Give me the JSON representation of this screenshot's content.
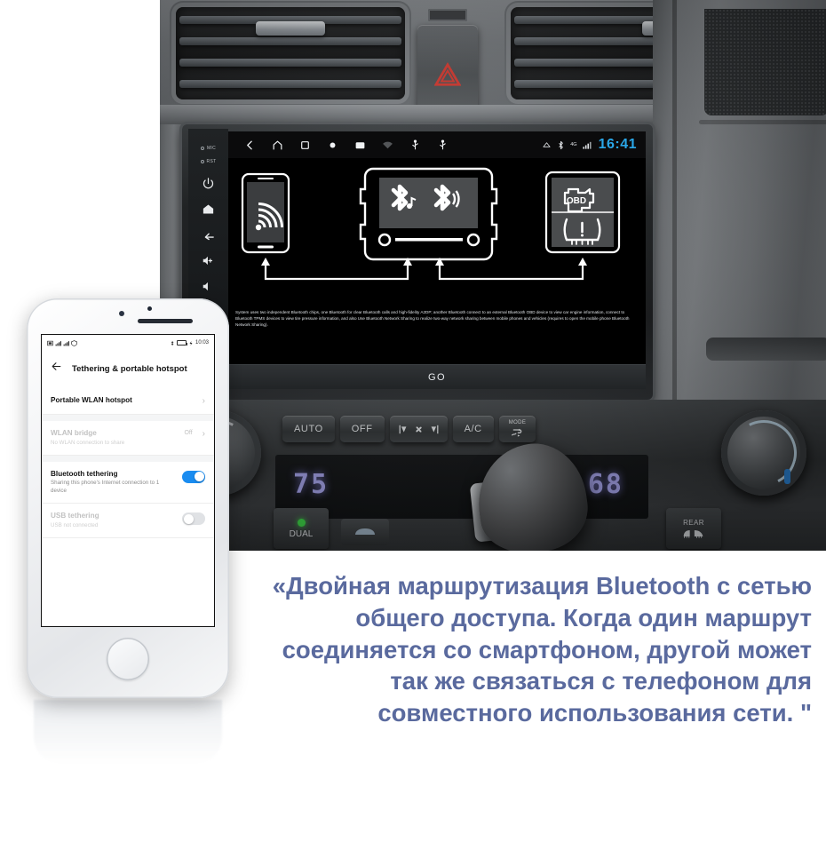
{
  "dashboard": {
    "hazard_button": "hazard-warning",
    "head_unit": {
      "hard_keys": {
        "mic_label": "MIC",
        "rst_label": "RST",
        "power": "power-icon",
        "home": "home-icon",
        "back": "back-icon",
        "volume_up": "volume-up-icon"
      },
      "status_bar": {
        "nav_icons": [
          "back-icon",
          "home-icon",
          "recents-icon",
          "circle-icon",
          "screenshot-icon",
          "wifi-icon",
          "usb-icon",
          "usb-icon"
        ],
        "right_icons": [
          "eject-icon",
          "bluetooth-icon",
          "4g-icon",
          "signal-icon"
        ],
        "network_label": "4G",
        "clock": "16:41"
      },
      "diagram": {
        "left_device": "smartphone-hotspot",
        "center_device": "car-head-unit-dual-bluetooth",
        "right_device": "obd-tpms-module",
        "obd_label": "OBD",
        "bt_left": "bluetooth-music-icon",
        "bt_right": "bluetooth-call-icon"
      },
      "description": "System uses two independent Bluetooth chips, one Bluetooth for clear Bluetooth calls and high-fidelity A2DP; another Bluetooth connect to an external Bluetooth OBD device to view car engine information, connect to Bluetooth TPMS devices to view tire pressure information, and also Use Bluetooth Network Sharing to realize two-way network sharing between mobile phones and vehicles (requires to open the mobile phone Bluetooth Network Sharing).",
      "go_button": "GO"
    },
    "climate": {
      "buttons": [
        {
          "label": "AUTO",
          "name": "auto-button"
        },
        {
          "label": "OFF",
          "name": "off-button"
        },
        {
          "label": "",
          "name": "fan-speed-button"
        },
        {
          "label": "A/C",
          "name": "ac-button"
        },
        {
          "label": "MODE",
          "name": "mode-button"
        }
      ],
      "display_left": "75",
      "display_right": "68",
      "dual_label": "DUAL",
      "rear_label": "REAR",
      "recirculate": "recirculation-icon"
    }
  },
  "phone": {
    "status_bar": {
      "time": "10:03",
      "battery": "battery-icon",
      "bluetooth": "bluetooth-icon",
      "signal": "signal-icon"
    },
    "app_bar": {
      "back": "back-arrow-icon",
      "title": "Tethering & portable hotspot"
    },
    "rows": [
      {
        "title": "Portable WLAN hotspot",
        "subtitle": "",
        "control": "chevron",
        "value": "",
        "enabled": true
      },
      {
        "title": "WLAN bridge",
        "subtitle": "No WLAN connection to share",
        "control": "chevron",
        "value": "Off",
        "enabled": false
      },
      {
        "title": "Bluetooth tethering",
        "subtitle": "Sharing this phone's Internet connection to 1 device",
        "control": "toggle-on",
        "value": "",
        "enabled": true
      },
      {
        "title": "USB tethering",
        "subtitle": "USB not connected",
        "control": "toggle-off",
        "value": "",
        "enabled": false
      }
    ]
  },
  "caption": {
    "text": "«Двойная маршрутизация Bluetooth с сетью общего доступа. Когда один маршрут соединяется со смартфоном, другой может так же связаться с телефоном для совместного использования сети. \"",
    "color": "#5a6a9e"
  }
}
